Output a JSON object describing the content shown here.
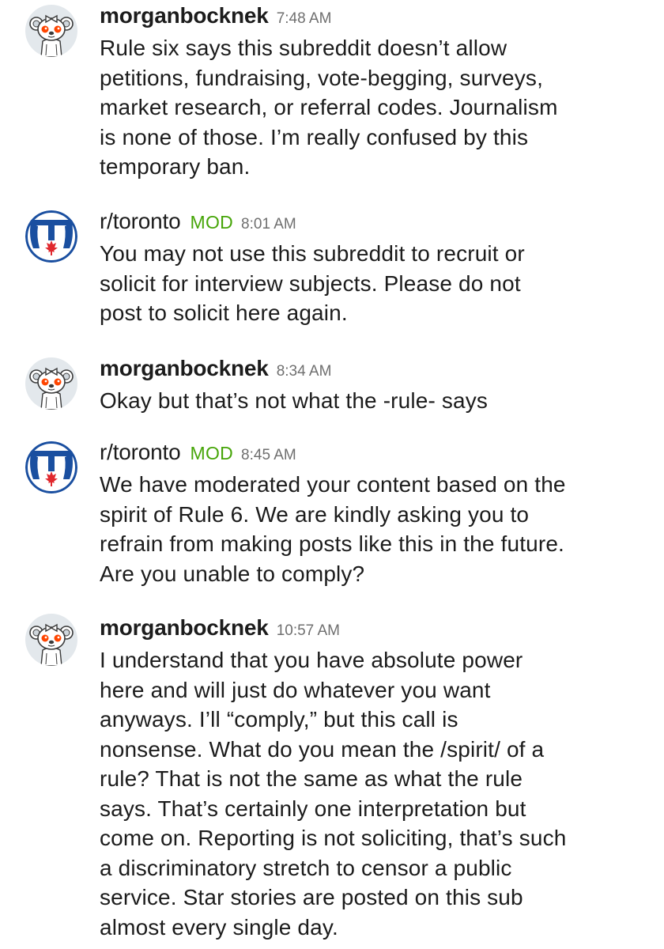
{
  "colors": {
    "mod_badge": "#46a508",
    "timestamp": "#6f6f6f",
    "text": "#1c1c1c",
    "avatar_bg": "#e3e8ec",
    "toronto_blue": "#1a4fa0",
    "toronto_red": "#e0282e"
  },
  "messages": [
    {
      "author": "morganbocknek",
      "avatar_icon": "snoo-avatar-icon",
      "time": "7:48 AM",
      "text": "Rule six says this subreddit doesn’t allow\npetitions, fundraising, vote-begging, surveys,\nmarket research, or referral codes. Journalism\nis none of those. I’m really confused by this\ntemporary ban."
    },
    {
      "author": "r/toronto",
      "badge": "MOD",
      "avatar_icon": "toronto-subreddit-icon",
      "time": "8:01 AM",
      "text": "You may not use this subreddit to recruit or\nsolicit for interview subjects. Please do not\npost to solicit here again."
    },
    {
      "author": "morganbocknek",
      "avatar_icon": "snoo-avatar-icon",
      "time": "8:34 AM",
      "text": "Okay but that’s not what the -rule- says"
    },
    {
      "author": "r/toronto",
      "badge": "MOD",
      "avatar_icon": "toronto-subreddit-icon",
      "time": "8:45 AM",
      "text": "We have moderated your content based on the\nspirit of Rule 6. We are kindly asking you to\nrefrain from making posts like this in the future.\nAre you unable to comply?"
    },
    {
      "author": "morganbocknek",
      "avatar_icon": "snoo-avatar-icon",
      "time": "10:57 AM",
      "text": "I understand that you have absolute power\nhere and will just do whatever you want\nanyways. I’ll “comply,” but this call is\nnonsense. What do you mean the /spirit/ of a\nrule? That is not the same as what the rule\nsays. That’s certainly one interpretation but\ncome on. Reporting is not soliciting, that’s such\na discriminatory stretch to censor a public\nservice. Star stories are posted on this sub\nalmost every single day."
    }
  ]
}
